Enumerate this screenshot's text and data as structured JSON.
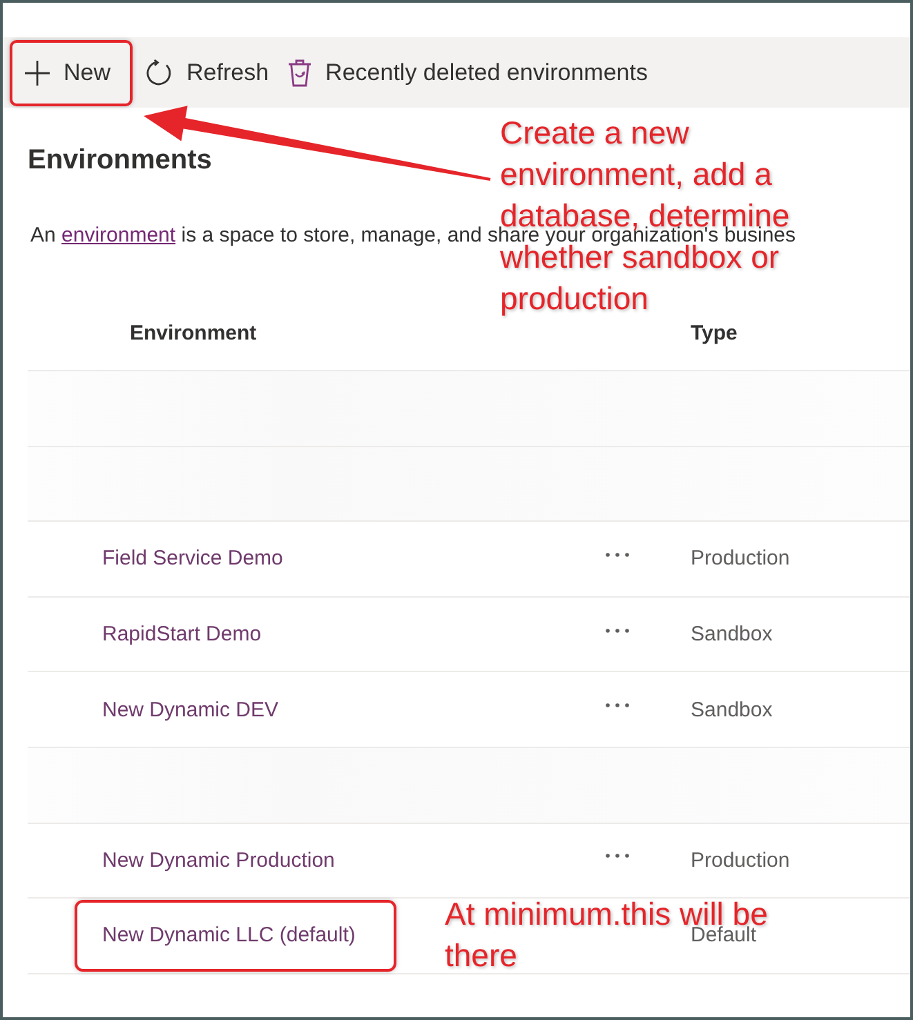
{
  "toolbar": {
    "buttons": [
      {
        "kind": "add",
        "label": "New",
        "highlighted": true
      },
      {
        "kind": "refresh",
        "label": "Refresh",
        "highlighted": false
      },
      {
        "kind": "trash",
        "label": "Recently deleted environments",
        "highlighted": false
      }
    ]
  },
  "heading": "Environments",
  "description": {
    "before": "An ",
    "link": "environment",
    "after": " is a space to store, manage, and share your organization's busines"
  },
  "table": {
    "columns": [
      "Environment",
      "Type"
    ],
    "rows": [
      {
        "kind": "blurred"
      },
      {
        "kind": "blurred"
      },
      {
        "kind": "environment",
        "name": "Field Service Demo",
        "type": "Production",
        "actions": true,
        "highlighted": false
      },
      {
        "kind": "environment",
        "name": "RapidStart Demo",
        "type": "Sandbox",
        "actions": true,
        "highlighted": false
      },
      {
        "kind": "environment",
        "name": "New Dynamic DEV",
        "type": "Sandbox",
        "actions": true,
        "highlighted": false
      },
      {
        "kind": "blurred"
      },
      {
        "kind": "environment",
        "name": "New Dynamic Production",
        "type": "Production",
        "actions": true,
        "highlighted": false
      },
      {
        "kind": "environment",
        "name": "New Dynamic LLC (default)",
        "type": "Default",
        "actions": false,
        "highlighted": true
      }
    ]
  },
  "annotations": [
    {
      "kind": "arrow-callout",
      "lines": [
        "Create a new",
        "environment, add a",
        "database, determine",
        "whether sandbox or",
        "production"
      ]
    },
    {
      "kind": "note",
      "lines": [
        "At minimum.this will be",
        "there"
      ]
    }
  ]
}
